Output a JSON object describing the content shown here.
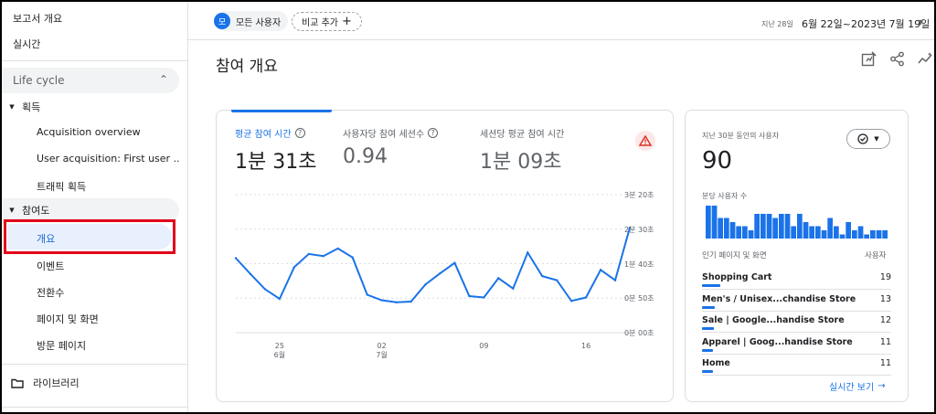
{
  "sidebar": {
    "report_overview": "보고서 개요",
    "realtime": "실시간",
    "lifecycle": "Life cycle",
    "acquisition": {
      "title": "획득",
      "items": [
        "Acquisition overview",
        "User acquisition: First user ...",
        "트래픽 획득"
      ]
    },
    "engagement": {
      "title": "참여도",
      "selected": "개요",
      "items": [
        "이벤트",
        "전환수",
        "페이지 및 화면",
        "방문 페이지"
      ]
    },
    "library": "라이브러리"
  },
  "topbar": {
    "avatar_letter": "모",
    "segment": "모든 사용자",
    "add_comparison": "비교 추가",
    "date_range_label": "지난 28일",
    "date_range": "6월 22일~2023년 7월 19일"
  },
  "page": {
    "title": "참여 개요"
  },
  "metrics": [
    {
      "label": "평균 참여 시간",
      "value": "1분 31초"
    },
    {
      "label": "사용자당 참여 세션수",
      "value": "0.94"
    },
    {
      "label": "세션당 평균 참여 시간",
      "value": "1분 09초"
    }
  ],
  "chart_data": {
    "type": "line",
    "y_ticks": [
      "3분 20초",
      "2분 30초",
      "1분 40초",
      "0분 50초",
      "0분 00초"
    ],
    "ylim": [
      0,
      200
    ],
    "x_ticks": [
      {
        "day": "25",
        "month": "6월",
        "index": 3
      },
      {
        "day": "02",
        "month": "7월",
        "index": 10
      },
      {
        "day": "09",
        "month": "",
        "index": 17
      },
      {
        "day": "16",
        "month": "",
        "index": 24
      }
    ],
    "series": [
      {
        "values": [
          108,
          85,
          63,
          49,
          95,
          114,
          111,
          122,
          109,
          55,
          47,
          44,
          45,
          70,
          86,
          101,
          53,
          51,
          79,
          64,
          116,
          82,
          76,
          46,
          51,
          91,
          76,
          152
        ]
      }
    ],
    "color": "#1a73e8"
  },
  "realtime": {
    "title": "지난 30분 동안의 사용자",
    "users": "90",
    "per_minute_label": "분당 사용자 수",
    "bars": [
      8,
      8,
      5,
      5,
      4,
      3,
      3,
      2,
      6,
      6,
      6,
      5,
      6,
      6,
      3,
      6,
      4,
      3,
      3,
      2,
      5,
      3,
      1,
      4,
      2,
      3,
      1,
      2,
      2,
      2
    ],
    "table_header_name": "인기 페이지 및 화면",
    "table_header_count": "사용자",
    "rows": [
      {
        "name": "Shopping Cart",
        "count": "19",
        "frac": 1.0
      },
      {
        "name": "Men's / Unisex...chandise Store",
        "count": "13",
        "frac": 0.68
      },
      {
        "name": "Sale | Google...handise Store",
        "count": "12",
        "frac": 0.63
      },
      {
        "name": "Apparel | Goog...handise Store",
        "count": "11",
        "frac": 0.58
      },
      {
        "name": "Home",
        "count": "11",
        "frac": 0.58
      }
    ],
    "link": "실시간 보기"
  },
  "colors": {
    "accent": "#1a73e8",
    "highlight_box": "#e2001a",
    "warning": "#d93025"
  }
}
